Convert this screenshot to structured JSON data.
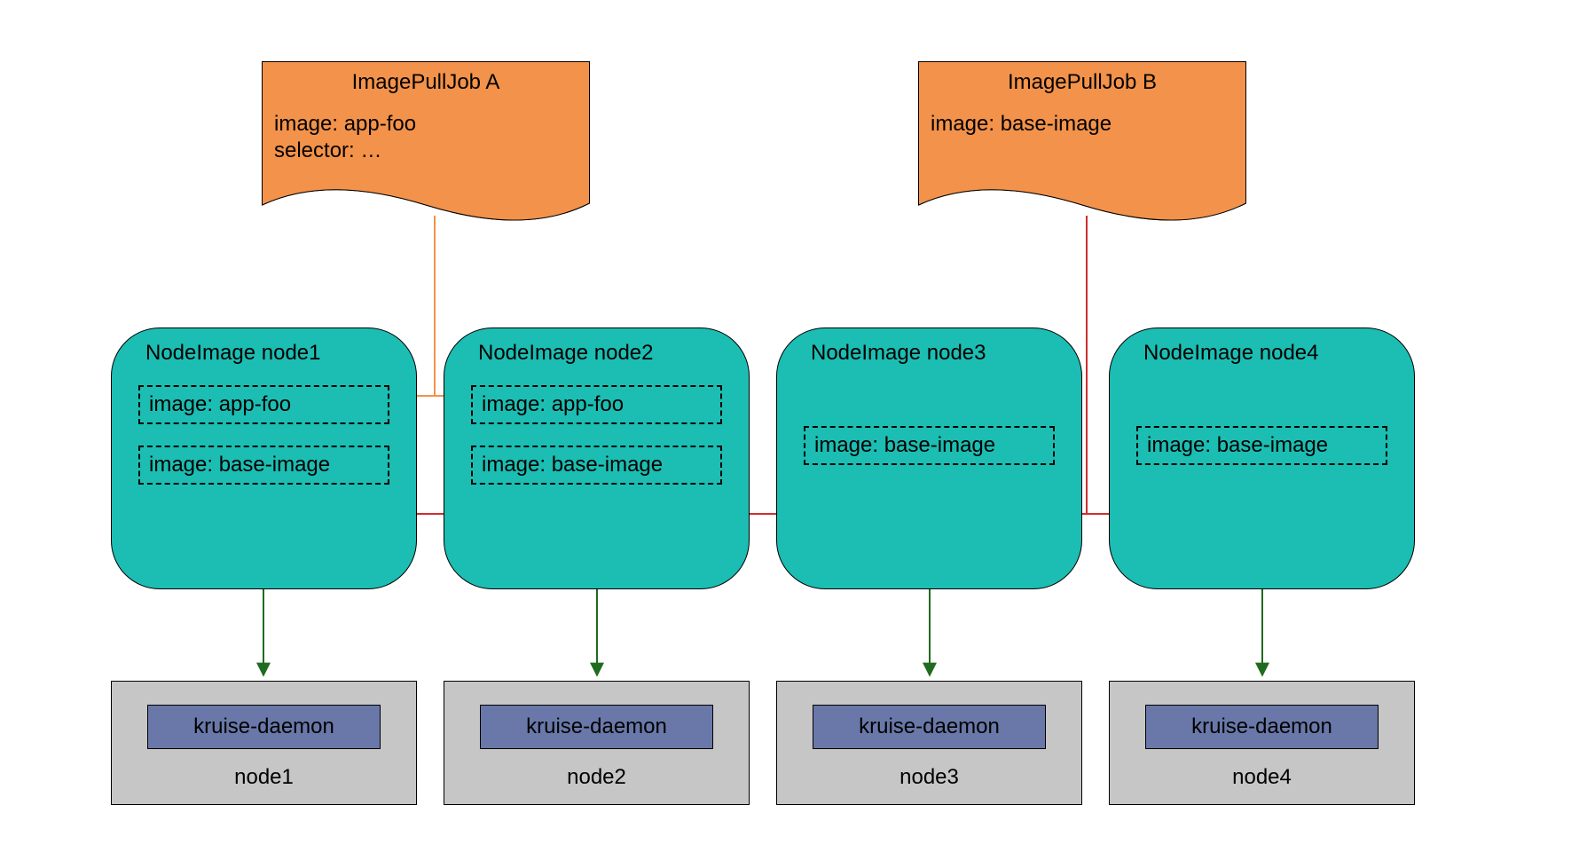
{
  "jobs": {
    "a": {
      "title": "ImagePullJob A",
      "line1": "image: app-foo",
      "line2": "selector: …"
    },
    "b": {
      "title": "ImagePullJob B",
      "line1": "image: base-image",
      "line2": ""
    }
  },
  "nodeimages": {
    "n1": {
      "title": "NodeImage node1",
      "img1": "image: app-foo",
      "img2": "image: base-image"
    },
    "n2": {
      "title": "NodeImage node2",
      "img1": "image: app-foo",
      "img2": "image: base-image"
    },
    "n3": {
      "title": "NodeImage node3",
      "img2": "image: base-image"
    },
    "n4": {
      "title": "NodeImage node4",
      "img2": "image: base-image"
    }
  },
  "daemon_label": "kruise-daemon",
  "nodes": {
    "n1": "node1",
    "n2": "node2",
    "n3": "node3",
    "n4": "node4"
  },
  "colors": {
    "doc_fill": "#f3924a",
    "nodeimage_fill": "#1cbdb2",
    "nodebox_fill": "#c6c6c6",
    "daemon_fill": "#6978a8",
    "arrow_orange": "#f3924a",
    "arrow_red": "#cf2e2e",
    "arrow_green": "#1f6b1f"
  }
}
